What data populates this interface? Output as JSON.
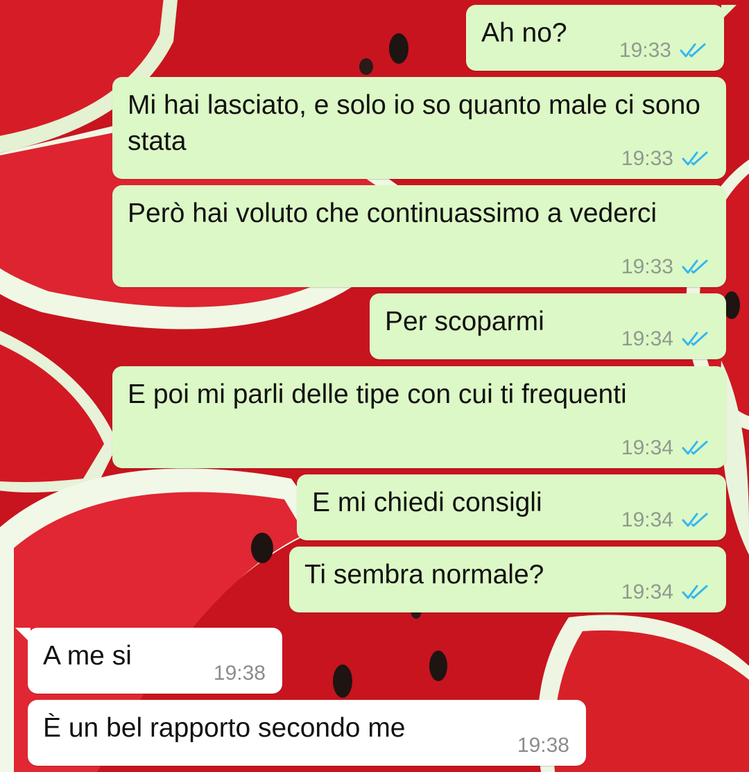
{
  "colors": {
    "outgoing_bubble": "#dcf8c6",
    "incoming_bubble": "#ffffff",
    "read_ticks": "#34b7f1",
    "wallpaper_flesh": "#d81b24",
    "wallpaper_rind": "#e9f3d6"
  },
  "wallpaper": {
    "subject": "watermelon slices"
  },
  "messages": [
    {
      "direction": "out",
      "text": "Ah no?",
      "time": "19:33",
      "status_icon": "double-check-read-icon"
    },
    {
      "direction": "out",
      "text": "Mi hai lasciato, e solo io so quanto male ci sono stata",
      "time": "19:33",
      "status_icon": "double-check-read-icon"
    },
    {
      "direction": "out",
      "text": "Però hai voluto che continuassimo a vederci",
      "time": "19:33",
      "status_icon": "double-check-read-icon"
    },
    {
      "direction": "out",
      "text": "Per scoparmi",
      "time": "19:34",
      "status_icon": "double-check-read-icon"
    },
    {
      "direction": "out",
      "text": "E poi mi parli delle tipe con cui ti frequenti",
      "time": "19:34",
      "status_icon": "double-check-read-icon"
    },
    {
      "direction": "out",
      "text": "E mi chiedi consigli",
      "time": "19:34",
      "status_icon": "double-check-read-icon"
    },
    {
      "direction": "out",
      "text": "Ti sembra normale?",
      "time": "19:34",
      "status_icon": "double-check-read-icon"
    },
    {
      "direction": "in",
      "text": "A me si",
      "time": "19:38"
    },
    {
      "direction": "in",
      "text": "È un bel rapporto secondo me",
      "time": "19:38"
    }
  ]
}
